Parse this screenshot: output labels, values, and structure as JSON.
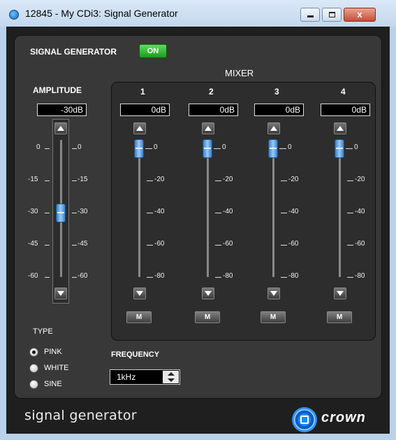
{
  "window": {
    "title": "12845 - My CDi3: Signal Generator",
    "close_label": "x"
  },
  "signal_generator": {
    "label": "SIGNAL GENERATOR",
    "state": "ON"
  },
  "amplitude": {
    "label": "AMPLITUDE",
    "readout": "-30dB",
    "value_db": -30,
    "scale_left": [
      "0",
      "-15",
      "-30",
      "-45",
      "-60"
    ],
    "scale_right": [
      "0",
      "-15",
      "-30",
      "-45",
      "-60"
    ]
  },
  "mixer": {
    "label": "MIXER",
    "scale": [
      "0",
      "-20",
      "-40",
      "-60",
      "-80"
    ],
    "mute_label": "M",
    "channels": [
      {
        "number": "1",
        "readout": "0dB",
        "value_db": 0
      },
      {
        "number": "2",
        "readout": "0dB",
        "value_db": 0
      },
      {
        "number": "3",
        "readout": "0dB",
        "value_db": 0
      },
      {
        "number": "4",
        "readout": "0dB",
        "value_db": 0
      }
    ]
  },
  "type": {
    "label": "TYPE",
    "options": [
      "PINK",
      "WHITE",
      "SINE"
    ],
    "selected": "PINK"
  },
  "frequency": {
    "label": "FREQUENCY",
    "value": "1kHz"
  },
  "footer": {
    "label": "signal generator",
    "brand": "crown"
  },
  "colors": {
    "on_button": "#2fb52f",
    "thumb": "#3b7fc9",
    "panel": "#383838"
  }
}
